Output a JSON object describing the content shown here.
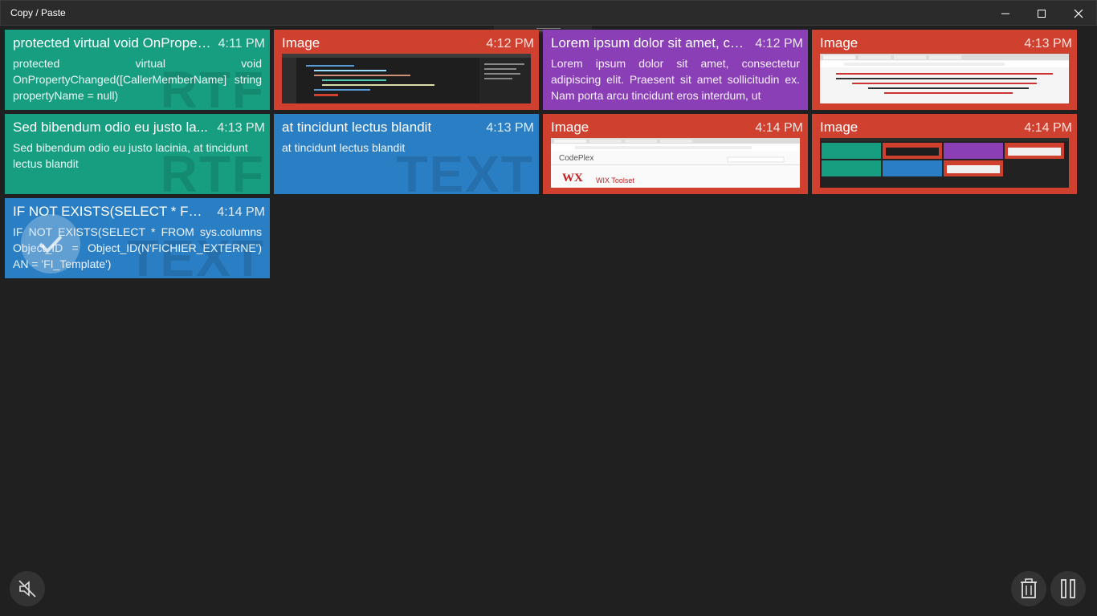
{
  "window": {
    "title": "Copy / Paste",
    "controls": [
      "minimize-icon",
      "maximize-icon",
      "close-icon"
    ]
  },
  "clips": [
    {
      "kind": "rtf",
      "title": "protected virtual void OnProper...",
      "time": "4:11 PM",
      "body": "protected virtual void OnPropertyChanged([CallerMemberName] string propertyName = null)",
      "watermark": "RTF"
    },
    {
      "kind": "image",
      "title": "Image",
      "time": "4:12 PM",
      "thumbnail": "code-editor-screenshot"
    },
    {
      "kind": "html",
      "title": "Lorem ipsum dolor sit amet, co...",
      "time": "4:12 PM",
      "body": "Lorem ipsum dolor sit amet, consectetur adipiscing elit. Praesent sit amet sollicitudin ex. Nam porta arcu tincidunt eros interdum, ut"
    },
    {
      "kind": "image",
      "title": "Image",
      "time": "4:13 PM",
      "thumbnail": "browser-bookmarks-screenshot"
    },
    {
      "kind": "rtf",
      "title": "Sed bibendum odio eu justo la...",
      "time": "4:13 PM",
      "body": "Sed bibendum odio eu justo lacinia, at tincidunt lectus blandit",
      "watermark": "RTF"
    },
    {
      "kind": "text",
      "title": "at tincidunt lectus blandit",
      "time": "4:13 PM",
      "body": "at tincidunt lectus blandit",
      "watermark": "TEXT"
    },
    {
      "kind": "image",
      "title": "Image",
      "time": "4:14 PM",
      "thumbnail": "codeplex-browser-screenshot",
      "thumb_text": [
        "CodePlex",
        "WX",
        "WIX Toolset"
      ]
    },
    {
      "kind": "image",
      "title": "Image",
      "time": "4:14 PM",
      "thumbnail": "app-tiles-screenshot"
    },
    {
      "kind": "text",
      "title": "IF NOT EXISTS(SELECT * FROM...",
      "time": "4:14 PM",
      "body": "IF NOT EXISTS(SELECT * FROM sys.columns Object_ID = Object_ID(N'FICHIER_EXTERNE') AN = 'FI_Template')",
      "watermark": "TEXT",
      "selected": true
    }
  ],
  "colors": {
    "background": "#202020",
    "rtf": "#179e80",
    "text": "#2a7fc4",
    "image": "#d0402f",
    "html": "#8a3fb6"
  },
  "toolbar": {
    "left_icon": "mute-notifications-icon",
    "right_icons": [
      "trash-icon",
      "pause-icon"
    ]
  }
}
